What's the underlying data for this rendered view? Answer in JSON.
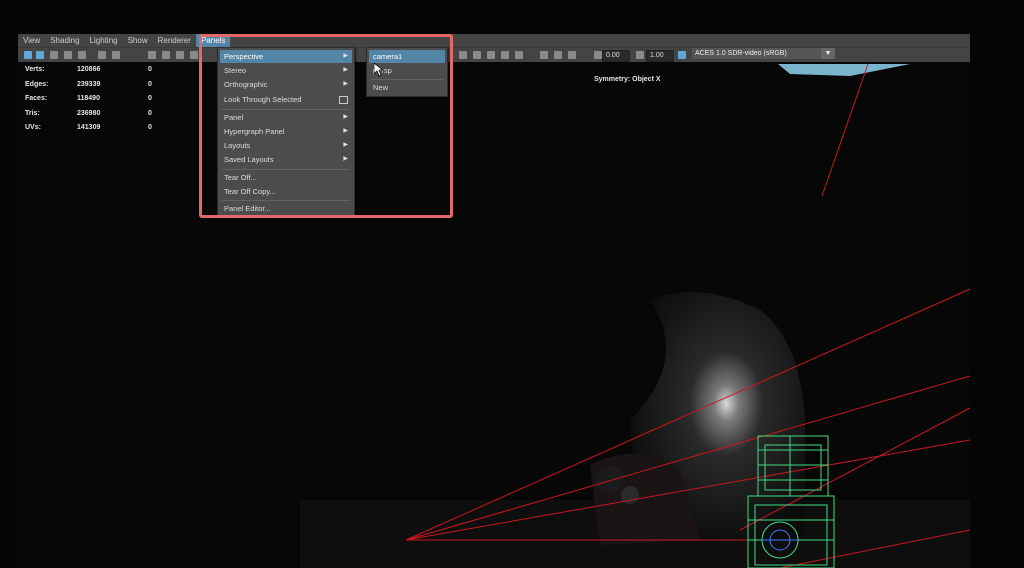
{
  "menubar": {
    "items": [
      "View",
      "Shading",
      "Lighting",
      "Show",
      "Renderer",
      "Panels"
    ],
    "active": "Panels"
  },
  "toolbar": {
    "exposure_value": "0.00",
    "gamma_value": "1.00",
    "color_space": "ACES 1.0 SDR-video (sRGB)"
  },
  "hud": {
    "rows": [
      {
        "label": "Verts:",
        "value": "120866",
        "selected": "0"
      },
      {
        "label": "Edges:",
        "value": "239339",
        "selected": "0"
      },
      {
        "label": "Faces:",
        "value": "118490",
        "selected": "0"
      },
      {
        "label": "Tris:",
        "value": "236980",
        "selected": "0"
      },
      {
        "label": "UVs:",
        "value": "141309",
        "selected": "0"
      }
    ],
    "symmetry": "Symmetry: Object X"
  },
  "panels_menu": {
    "items": [
      {
        "label": "Perspective",
        "submenu": true
      },
      {
        "label": "Stereo",
        "submenu": true
      },
      {
        "label": "Orthographic",
        "submenu": true
      },
      {
        "label": "Look Through Selected",
        "option_box": true
      },
      {
        "label": "Panel",
        "submenu": true
      },
      {
        "label": "Hypergraph Panel",
        "submenu": true
      },
      {
        "label": "Layouts",
        "submenu": true
      },
      {
        "label": "Saved Layouts",
        "submenu": true
      },
      {
        "label": "Tear Off..."
      },
      {
        "label": "Tear Off Copy..."
      },
      {
        "label": "Panel Editor..."
      }
    ]
  },
  "perspective_submenu": {
    "items": [
      "camera1",
      "persp",
      "New"
    ]
  },
  "colors": {
    "menu_highlight": "#5285a6",
    "callout_border": "#e06a6a",
    "wireframe_green": "#3ddc84",
    "guide_red": "#c8181f"
  }
}
